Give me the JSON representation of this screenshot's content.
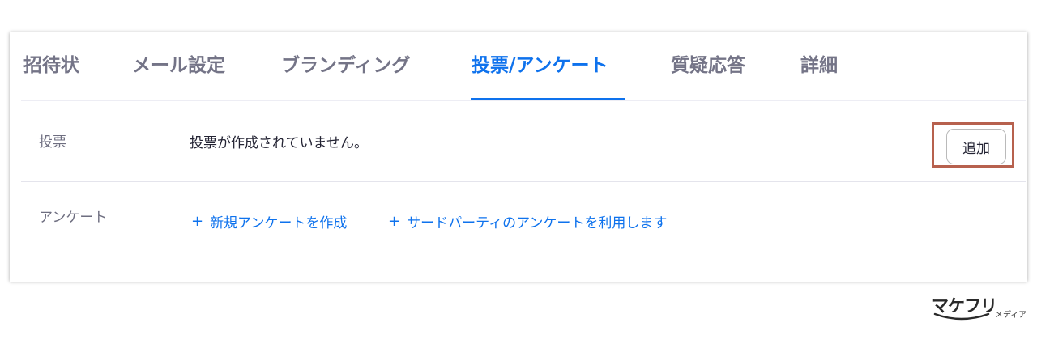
{
  "tabs": [
    {
      "label": "招待状",
      "active": false
    },
    {
      "label": "メール設定",
      "active": false
    },
    {
      "label": "ブランディング",
      "active": false
    },
    {
      "label": "投票/アンケート",
      "active": true
    },
    {
      "label": "質疑応答",
      "active": false
    },
    {
      "label": "詳細",
      "active": false
    }
  ],
  "polls": {
    "label": "投票",
    "empty_message": "投票が作成されていません。",
    "add_button_label": "追加"
  },
  "survey": {
    "label": "アンケート",
    "create_new_label": "新規アンケートを作成",
    "third_party_label": "サードパーティのアンケートを利用します"
  },
  "logo": {
    "text": "マケフリ",
    "sub_text": "メディア"
  },
  "colors": {
    "accent": "#0e72ed",
    "tab_inactive": "#747487",
    "highlight_border": "#b7614e"
  }
}
